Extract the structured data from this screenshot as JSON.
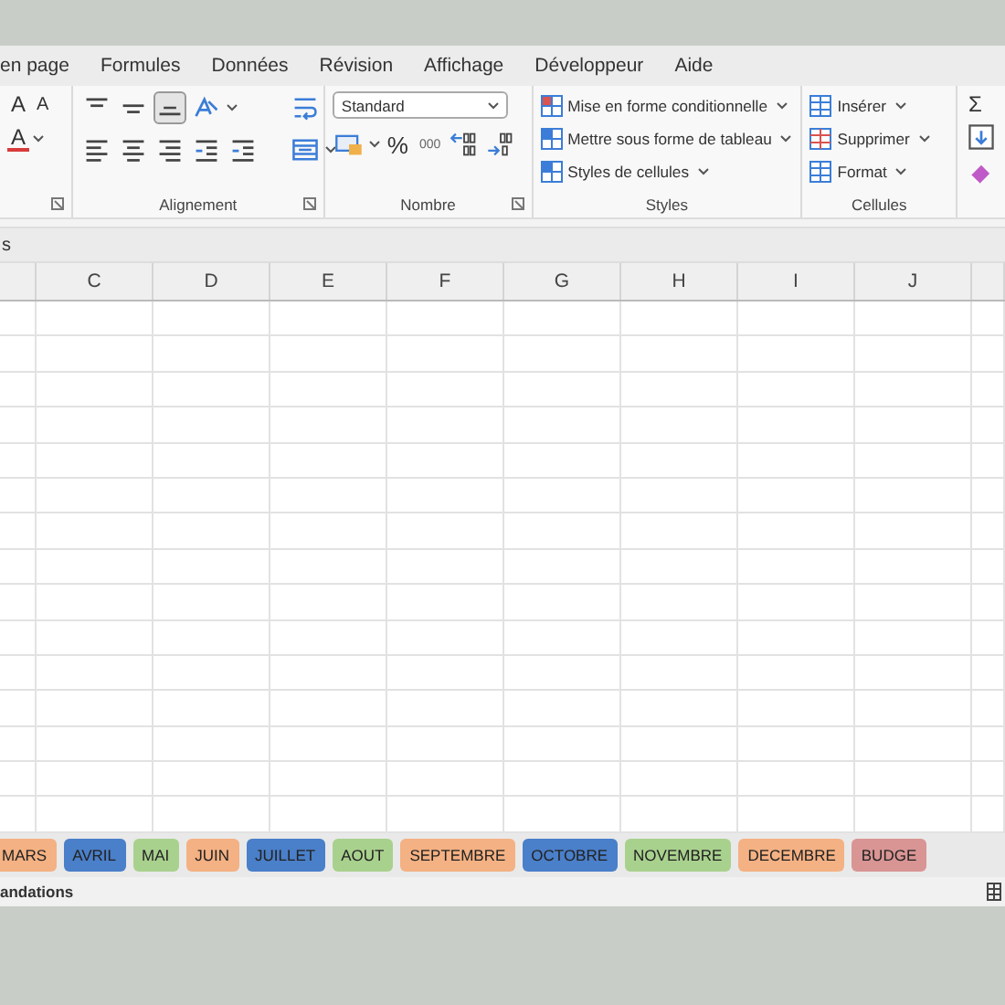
{
  "menu_tabs": [
    "en page",
    "Formules",
    "Données",
    "Révision",
    "Affichage",
    "Développeur",
    "Aide"
  ],
  "ribbon": {
    "font": {
      "size_buttons": [
        "A",
        "A"
      ],
      "color_button": "A"
    },
    "alignment": {
      "label": "Alignement"
    },
    "number": {
      "label": "Nombre",
      "format": "Standard",
      "percent": "%",
      "thousands": "000"
    },
    "styles": {
      "label": "Styles",
      "items": [
        "Mise en forme conditionnelle",
        "Mettre sous forme de tableau",
        "Styles de cellules"
      ]
    },
    "cells": {
      "label": "Cellules",
      "items": [
        "Insérer",
        "Supprimer",
        "Format"
      ]
    },
    "editing": {
      "sum": "Σ"
    }
  },
  "formula_bar": {
    "name_box": "s"
  },
  "columns": [
    "C",
    "D",
    "E",
    "F",
    "G",
    "H",
    "I",
    "J"
  ],
  "sheet_tabs": [
    {
      "label": "MARS",
      "color": "#f4b183"
    },
    {
      "label": "AVRIL",
      "color": "#4a7fc9"
    },
    {
      "label": "MAI",
      "color": "#a9d18e"
    },
    {
      "label": "JUIN",
      "color": "#f4b183"
    },
    {
      "label": "JUILLET",
      "color": "#4a7fc9"
    },
    {
      "label": "AOUT",
      "color": "#a9d18e"
    },
    {
      "label": "SEPTEMBRE",
      "color": "#f4b183"
    },
    {
      "label": "OCTOBRE",
      "color": "#4a7fc9"
    },
    {
      "label": "NOVEMBRE",
      "color": "#a9d18e"
    },
    {
      "label": "DECEMBRE",
      "color": "#f4b183"
    },
    {
      "label": "BUDGE",
      "color": "#d99594"
    }
  ],
  "status_bar": {
    "text": "andations"
  }
}
